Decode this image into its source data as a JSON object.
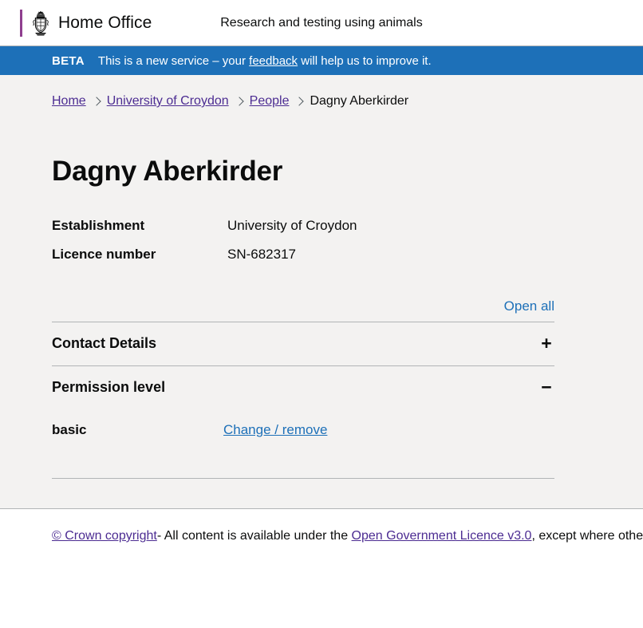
{
  "header": {
    "brand_name": "Home Office",
    "service_name": "Research and testing using animals",
    "crest_icon": "royal-coat-of-arms"
  },
  "phase_banner": {
    "tag": "BETA",
    "text_before": "This is a new service – your ",
    "link_label": "feedback",
    "text_after": " will help us to improve it."
  },
  "breadcrumb": {
    "items": [
      {
        "label": "Home",
        "is_link": true
      },
      {
        "label": "University of Croydon",
        "is_link": true
      },
      {
        "label": "People",
        "is_link": true
      },
      {
        "label": "Dagny Aberkirder",
        "is_link": false
      }
    ]
  },
  "main": {
    "page_title": "Dagny Aberkirder",
    "summary": [
      {
        "key": "Establishment",
        "value": "University of Croydon"
      },
      {
        "key": "Licence number",
        "value": "SN-682317"
      }
    ],
    "open_all_label": "Open all",
    "accordion": [
      {
        "title": "Contact Details",
        "toggle_icon": "+",
        "expanded": false
      },
      {
        "title": "Permission level",
        "toggle_icon": "−",
        "expanded": true,
        "permission_key": "basic",
        "permission_action_label": "Change / remove"
      }
    ]
  },
  "footer": {
    "copyright_link": "© Crown copyright",
    "text_middle": "- All content is available under the ",
    "licence_link": "Open Government Licence v3.0",
    "text_end": ", except where otherwise stated"
  },
  "colors": {
    "govuk_blue": "#1d70b8",
    "link_visited_purple": "#4c2c92",
    "brand_accent_purple": "#8f3f8f",
    "page_grey": "#f3f2f1",
    "border_grey": "#b1b4b6",
    "text_black": "#0b0c0c"
  }
}
